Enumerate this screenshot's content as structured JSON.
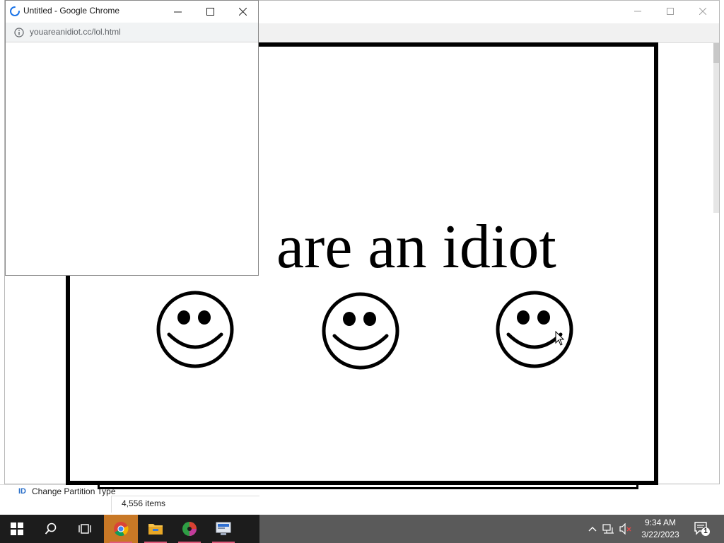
{
  "popup": {
    "title": "Untitled - Google Chrome",
    "url": "youareanidiot.cc/lol.html"
  },
  "page": {
    "headline": "are an idiot"
  },
  "explorer": {
    "item_label": "Change Partition Type",
    "status": "4,556 items"
  },
  "taskbar": {
    "time": "9:34 AM",
    "date": "3/22/2023",
    "notification_count": "1",
    "active_color": "#c87826"
  },
  "icons": {
    "start": "windows-logo-icon",
    "search": "search-icon",
    "task_view": "task-view-icon",
    "chrome": "chrome-icon",
    "explorer": "folder-icon",
    "app3": "pie-chart-app-icon",
    "app4": "monitor-app-icon"
  }
}
